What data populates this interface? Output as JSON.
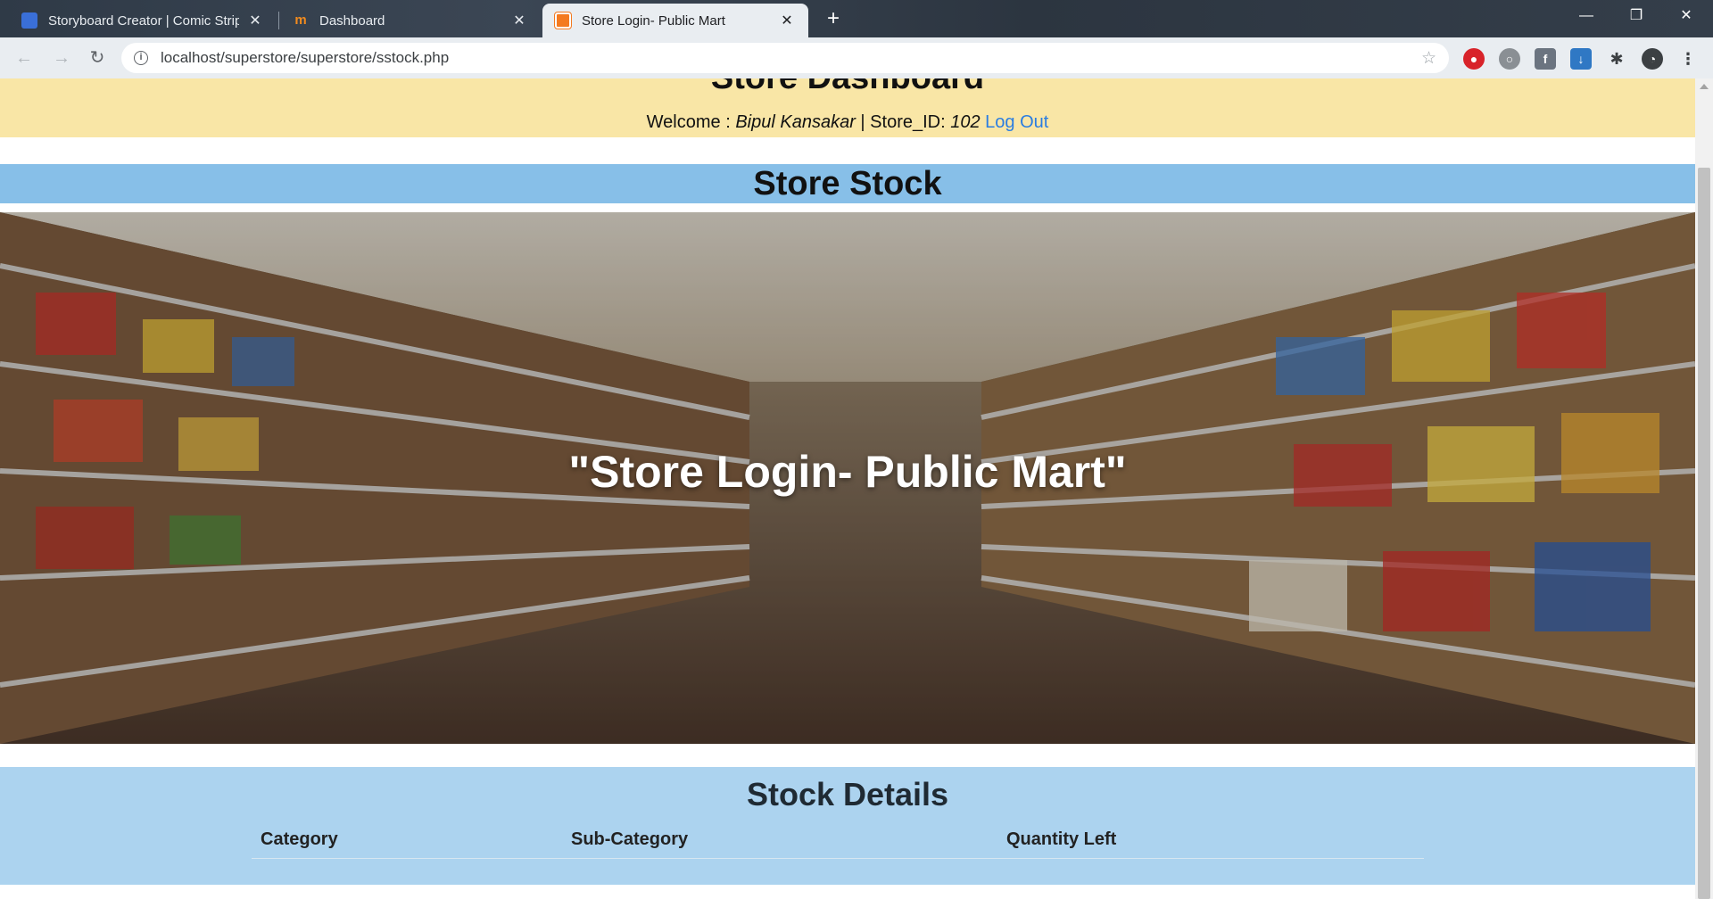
{
  "browser": {
    "tabs": [
      {
        "title": "Storyboard Creator | Comic Strip",
        "icon": "storyboard-icon",
        "active": false
      },
      {
        "title": "Dashboard",
        "icon": "dashboard-icon",
        "active": false
      },
      {
        "title": "Store Login- Public Mart",
        "icon": "xampp-icon",
        "active": true
      }
    ],
    "url": "localhost/superstore/superstore/sstock.php"
  },
  "page": {
    "dashboard_title": "Store Dashboard",
    "welcome_label": "Welcome : ",
    "user_name": "Bipul Kansakar",
    "store_id_label": " | Store_ID: ",
    "store_id": "102",
    "logout_label": "Log Out",
    "section_title": "Store Stock",
    "hero_text": "\"Store Login- Public Mart\"",
    "details_title": "Stock Details",
    "table_headers": [
      "Category",
      "Sub-Category",
      "Quantity Left"
    ]
  },
  "colors": {
    "header_bg": "#f9e6a6",
    "stock_banner_bg": "#87bfe8",
    "details_bg": "#acd3ef",
    "link": "#2a7de1"
  }
}
